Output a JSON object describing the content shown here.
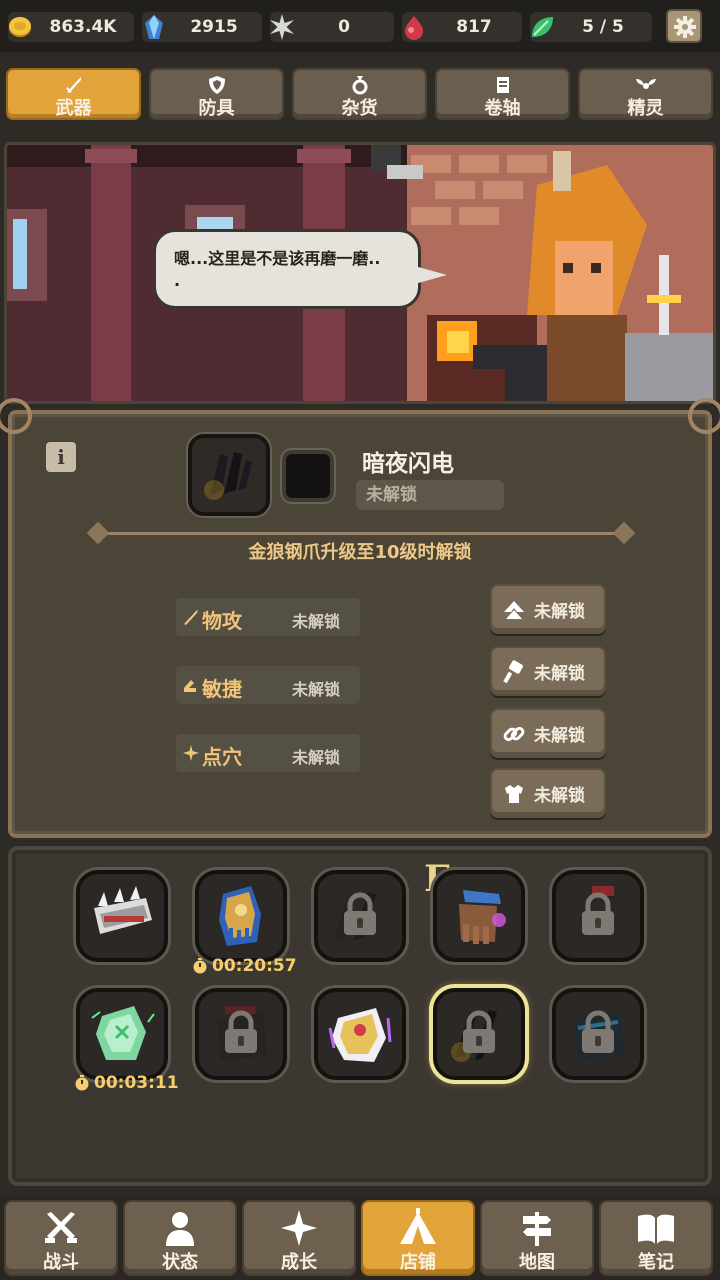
{
  "resources": {
    "gold": "863.4K",
    "crystal": "2915",
    "star": "0",
    "ruby": "817",
    "energy": "5 / 5"
  },
  "tabs": [
    {
      "label": "武器",
      "icon": "sword-icon",
      "active": true
    },
    {
      "label": "防具",
      "icon": "shield-icon",
      "active": false
    },
    {
      "label": "杂货",
      "icon": "ring-icon",
      "active": false
    },
    {
      "label": "卷轴",
      "icon": "scroll-icon",
      "active": false
    },
    {
      "label": "精灵",
      "icon": "wings-icon",
      "active": false
    }
  ],
  "scene": {
    "speech_line1": "嗯...这里是不是该再磨一磨..",
    "speech_line2": "."
  },
  "detail": {
    "item_name": "暗夜闪电",
    "item_status": "未解锁",
    "unlock_hint": "金狼钢爪升级至10级时解锁",
    "stats": [
      {
        "name": "物攻",
        "value": "未解锁",
        "icon": "sword-icon"
      },
      {
        "name": "敏捷",
        "value": "未解锁",
        "icon": "boot-icon"
      },
      {
        "name": "点穴",
        "value": "未解锁",
        "icon": "spark-icon"
      }
    ],
    "skills": [
      {
        "label": "未解锁",
        "icon": "upgrade-arrow-icon"
      },
      {
        "label": "未解锁",
        "icon": "hammer-icon"
      },
      {
        "label": "未解锁",
        "icon": "chain-link-icon"
      },
      {
        "label": "未解锁",
        "icon": "armor-icon"
      }
    ]
  },
  "inventory": {
    "grade_badge": "E",
    "timers": [
      "00:20:57",
      "00:03:11"
    ],
    "slots": [
      {
        "name": "spiked-bracer",
        "locked": false
      },
      {
        "name": "golden-gauntlet",
        "locked": false
      },
      {
        "name": "dark-claw",
        "locked": true
      },
      {
        "name": "rune-glove",
        "locked": false
      },
      {
        "name": "blood-claw",
        "locked": true
      },
      {
        "name": "jade-gauntlet",
        "locked": false
      },
      {
        "name": "iron-claw",
        "locked": true
      },
      {
        "name": "royal-glove",
        "locked": false
      },
      {
        "name": "night-lightning",
        "locked": true,
        "selected": true
      },
      {
        "name": "frost-claw",
        "locked": true
      }
    ]
  },
  "nav": [
    {
      "label": "战斗",
      "icon": "crossed-swords-icon",
      "active": false
    },
    {
      "label": "状态",
      "icon": "person-icon",
      "active": false
    },
    {
      "label": "成长",
      "icon": "sparkle-icon",
      "active": false
    },
    {
      "label": "店铺",
      "icon": "tent-icon",
      "active": true
    },
    {
      "label": "地图",
      "icon": "signpost-icon",
      "active": false
    },
    {
      "label": "笔记",
      "icon": "book-icon",
      "active": false
    }
  ],
  "colors": {
    "accent": "#e2a33a",
    "panel": "#4b4538",
    "stat_text": "#f1c47a",
    "timer_text": "#f6ce6c"
  }
}
